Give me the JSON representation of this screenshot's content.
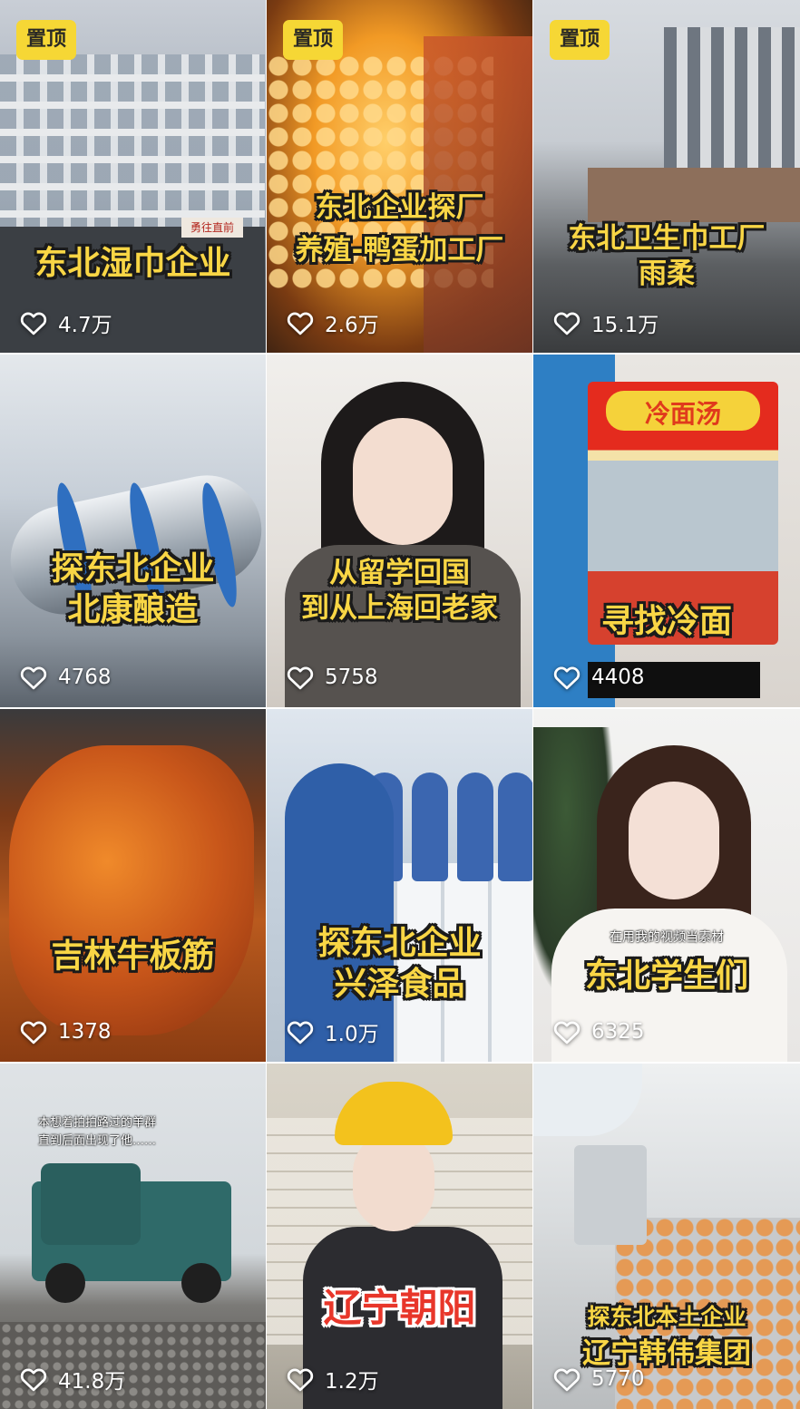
{
  "pin_label": "置顶",
  "tiles": [
    {
      "pinned": true,
      "caption_lines": [
        "东北湿巾企业"
      ],
      "likes": "4.7万",
      "scene_text": "勇往直前"
    },
    {
      "pinned": true,
      "caption_lines": [
        "东北企业探厂",
        "养殖-鸭蛋加工厂"
      ],
      "likes": "2.6万"
    },
    {
      "pinned": true,
      "caption_lines": [
        "东北卫生巾工厂",
        "雨柔"
      ],
      "likes": "15.1万"
    },
    {
      "pinned": false,
      "caption_lines": [
        "探东北企业",
        "北康酿造"
      ],
      "likes": "4768"
    },
    {
      "pinned": false,
      "caption_lines": [
        "从留学回国",
        "到从上海回老家"
      ],
      "likes": "5758"
    },
    {
      "pinned": false,
      "caption_lines": [
        "寻找冷面"
      ],
      "likes": "4408",
      "scene_text": "冷面汤"
    },
    {
      "pinned": false,
      "caption_lines": [
        "吉林牛板筋"
      ],
      "likes": "1378"
    },
    {
      "pinned": false,
      "caption_lines": [
        "探东北企业",
        "兴泽食品"
      ],
      "likes": "1.0万"
    },
    {
      "pinned": false,
      "caption_lines": [
        "东北学生们"
      ],
      "likes": "6325",
      "subtitle": "在用我的视频当素材"
    },
    {
      "pinned": false,
      "caption_lines": [],
      "likes": "41.8万",
      "note_lines": [
        "本想着拍拍路过的羊群",
        "直到后面出现了他……"
      ]
    },
    {
      "pinned": false,
      "caption_lines": [
        "辽宁朝阳"
      ],
      "likes": "1.2万"
    },
    {
      "pinned": false,
      "caption_lines": [
        "探东北本土企业",
        "辽宁韩伟集团"
      ],
      "likes": "5770"
    }
  ],
  "icons": {
    "like": "heart-outline-icon"
  },
  "colors": {
    "pin_bg": "#f6d735",
    "caption": "#f9d645",
    "caption_red": "#e8362a"
  }
}
